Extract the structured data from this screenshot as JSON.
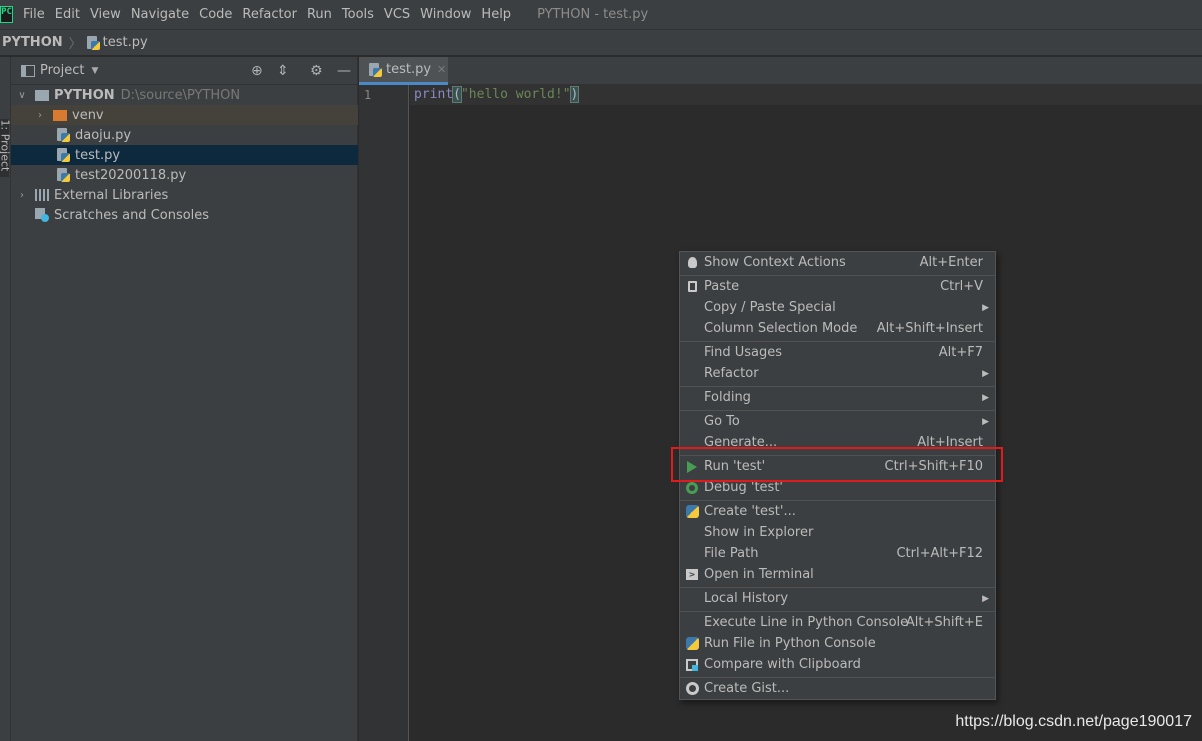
{
  "menubar": {
    "logo": "PC",
    "items": [
      "File",
      "Edit",
      "View",
      "Navigate",
      "Code",
      "Refactor",
      "Run",
      "Tools",
      "VCS",
      "Window",
      "Help"
    ],
    "window_title": "PYTHON - test.py"
  },
  "breadcrumb": {
    "project": "PYTHON",
    "file": "test.py"
  },
  "stripe": {
    "project_label": "1: Project"
  },
  "project_panel": {
    "title": "Project",
    "tree": {
      "root_name": "PYTHON",
      "root_path": "D:\\source\\PYTHON",
      "venv": "venv",
      "file1": "daoju.py",
      "file2": "test.py",
      "file3": "test20200118.py",
      "libraries": "External Libraries",
      "scratches": "Scratches and Consoles"
    }
  },
  "editor": {
    "tab_label": "test.py",
    "line_number": "1",
    "code": {
      "builtin": "print",
      "open_paren": "(",
      "string": "\"hello world!\"",
      "close_paren": ")"
    }
  },
  "context_menu": {
    "items": [
      {
        "label": "Show Context Actions",
        "shortcut": "Alt+Enter",
        "icon": "bulb-icon"
      },
      {
        "label": "Paste",
        "shortcut": "Ctrl+V",
        "icon": "paste-icon"
      },
      {
        "label": "Copy / Paste Special",
        "shortcut": "",
        "submenu": "▶"
      },
      {
        "label": "Column Selection Mode",
        "shortcut": "Alt+Shift+Insert"
      },
      {
        "label": "Find Usages",
        "shortcut": "Alt+F7"
      },
      {
        "label": "Refactor",
        "shortcut": "",
        "submenu": "▶"
      },
      {
        "label": "Folding",
        "shortcut": "",
        "submenu": "▶"
      },
      {
        "label": "Go To",
        "shortcut": "",
        "submenu": "▶"
      },
      {
        "label": "Generate...",
        "shortcut": "Alt+Insert"
      },
      {
        "label": "Run 'test'",
        "shortcut": "Ctrl+Shift+F10",
        "icon": "run-icon"
      },
      {
        "label": "Debug 'test'",
        "shortcut": "",
        "icon": "debug-icon"
      },
      {
        "label": "Create 'test'...",
        "shortcut": "",
        "icon": "python-icon"
      },
      {
        "label": "Show in Explorer",
        "shortcut": ""
      },
      {
        "label": "File Path",
        "shortcut": "Ctrl+Alt+F12"
      },
      {
        "label": "Open in Terminal",
        "shortcut": "",
        "icon": "terminal-icon"
      },
      {
        "label": "Local History",
        "shortcut": "",
        "submenu": "▶"
      },
      {
        "label": "Execute Line in Python Console",
        "shortcut": "Alt+Shift+E"
      },
      {
        "label": "Run File in Python Console",
        "shortcut": "",
        "icon": "python-icon"
      },
      {
        "label": "Compare with Clipboard",
        "shortcut": "",
        "icon": "compare-icon"
      },
      {
        "label": "Create Gist...",
        "shortcut": "",
        "icon": "github-icon"
      }
    ]
  },
  "watermark": "https://blog.csdn.net/page190017",
  "colors": {
    "background": "#2b2b2b",
    "panel": "#3c3f41",
    "selection": "#0d293e",
    "highlight_box": "#e01b1b",
    "run_green": "#499c54"
  }
}
